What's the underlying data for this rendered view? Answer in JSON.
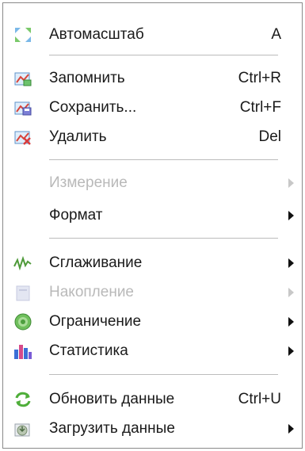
{
  "menu": {
    "items": [
      {
        "label": "Автомасштаб",
        "shortcut": "A",
        "icon": "autoscale-icon"
      },
      {
        "label": "Запомнить",
        "shortcut": "Ctrl+R",
        "icon": "remember-icon"
      },
      {
        "label": "Сохранить...",
        "shortcut": "Ctrl+F",
        "icon": "save-icon"
      },
      {
        "label": "Удалить",
        "shortcut": "Del",
        "icon": "delete-icon"
      },
      {
        "label": "Измерение",
        "disabled": true
      },
      {
        "label": "Формат"
      },
      {
        "label": "Сглаживание",
        "icon": "smoothing-icon"
      },
      {
        "label": "Накопление",
        "disabled": true,
        "icon": "accumulation-icon"
      },
      {
        "label": "Ограничение",
        "icon": "limit-icon"
      },
      {
        "label": "Статистика",
        "icon": "statistics-icon"
      },
      {
        "label": "Обновить данные",
        "shortcut": "Ctrl+U",
        "icon": "refresh-icon"
      },
      {
        "label": "Загрузить данные",
        "icon": "load-data-icon"
      }
    ]
  }
}
